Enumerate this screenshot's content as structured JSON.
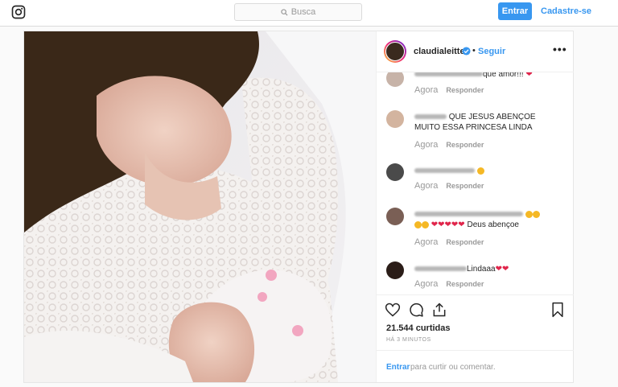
{
  "topbar": {
    "logo_icon": "instagram-icon",
    "search_placeholder": "Busca",
    "login_button": "Entrar",
    "signup_link": "Cadastre-se"
  },
  "post": {
    "username": "claudialeitte",
    "separator": "•",
    "follow": "Seguir",
    "more_icon": "•••",
    "likes": "21.544 curtidas",
    "timestamp": "HÁ 3 MINUTOS",
    "comment_prompt_link": "Entrar",
    "comment_prompt_rest": "para curtir ou comentar."
  },
  "comments": [
    {
      "text": "que amor!!!",
      "time": "Agora",
      "reply": "Responder"
    },
    {
      "text": "QUE JESUS ABENÇOE MUITO ESSA PRINCESA LINDA",
      "time": "Agora",
      "reply": "Responder"
    },
    {
      "text": "",
      "time": "Agora",
      "reply": "Responder"
    },
    {
      "text": "Deus abençoe",
      "time": "Agora",
      "reply": "Responder"
    },
    {
      "text": "Lindaaa",
      "time": "Agora",
      "reply": "Responder"
    }
  ],
  "colors": {
    "accent": "#3897f0",
    "heart": "#e0254b"
  }
}
